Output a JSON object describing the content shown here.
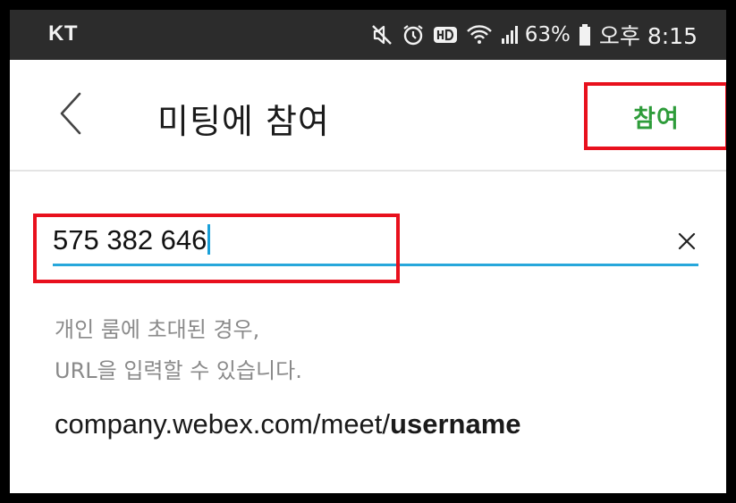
{
  "status_bar": {
    "carrier": "KT",
    "battery": "63%",
    "time": "오후 8:15",
    "icons": [
      "mute-icon",
      "alarm-icon",
      "hd-icon",
      "wifi-icon",
      "signal-icon",
      "battery-icon"
    ]
  },
  "app_bar": {
    "back_icon": "chevron-left-icon",
    "title": "미팅에 참여",
    "join_label": "참여"
  },
  "meeting_input": {
    "value": "575 382 646",
    "clear_icon": "close-icon"
  },
  "hint": {
    "line1": "개인 룸에 초대된 경우,",
    "line2": "URL을 입력할 수 있습니다."
  },
  "url_example": {
    "prefix": "company.webex.com/meet/",
    "bold": "username"
  },
  "colors": {
    "status_bar": "#2c2c2c",
    "accent_green": "#2e9c3a",
    "input_underline": "#27a7db",
    "highlight_red": "#e8101d",
    "hint_gray": "#8a8a8a"
  }
}
